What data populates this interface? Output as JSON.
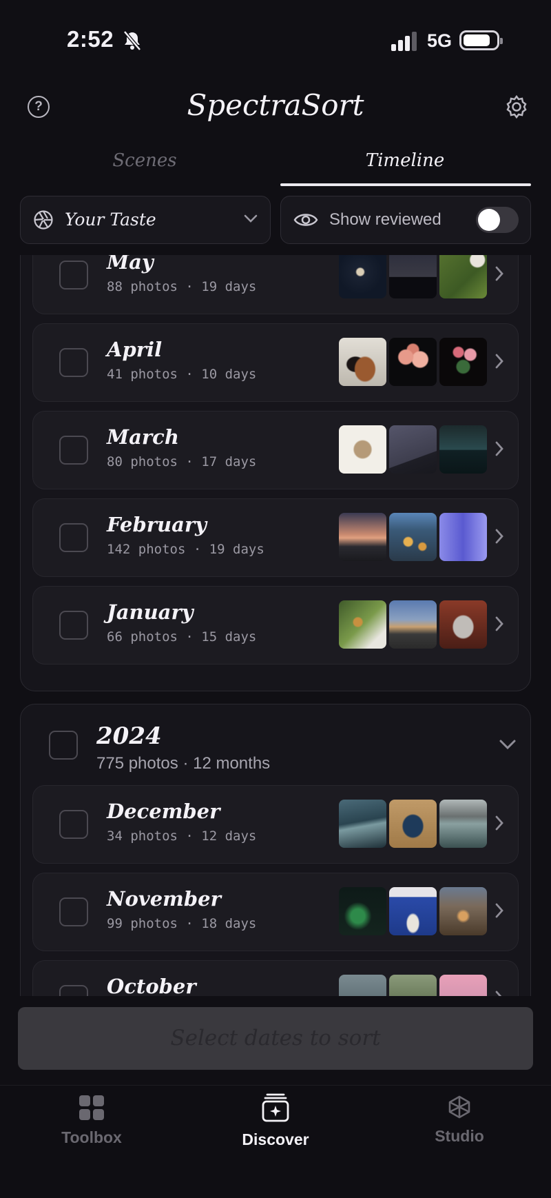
{
  "status_bar": {
    "time": "2:52",
    "network": "5G"
  },
  "header": {
    "title": "SpectraSort"
  },
  "tabs": [
    {
      "label": "Scenes",
      "active": false
    },
    {
      "label": "Timeline",
      "active": true
    }
  ],
  "filters": {
    "taste_label": "Your Taste",
    "show_reviewed_label": "Show reviewed",
    "show_reviewed_on": false
  },
  "years": [
    {
      "year": "",
      "months": [
        {
          "name": "May",
          "meta": "88 photos · 19 days",
          "thumb_colors": [
            "#101827",
            "#2a2a3a",
            "#4f6a2e"
          ]
        },
        {
          "name": "April",
          "meta": "41 photos · 10 days",
          "thumb_colors": [
            "#d8d4cc",
            "#8a3a3a",
            "#5a2a30"
          ]
        },
        {
          "name": "March",
          "meta": "80 photos · 17 days",
          "thumb_colors": [
            "#eeeae2",
            "#4a4a58",
            "#1e3238"
          ]
        },
        {
          "name": "February",
          "meta": "142 photos · 19 days",
          "thumb_colors": [
            "#b07a68",
            "#3e6a90",
            "#6a6adc"
          ]
        },
        {
          "name": "January",
          "meta": "66 photos · 15 days",
          "thumb_colors": [
            "#6f8a4a",
            "#6c88b8",
            "#7a3a2a"
          ]
        }
      ]
    },
    {
      "year": "2024",
      "meta": "775 photos · 12 months",
      "months": [
        {
          "name": "December",
          "meta": "34 photos · 12 days",
          "thumb_colors": [
            "#3a5560",
            "#b08a5a",
            "#7a8a8a"
          ]
        },
        {
          "name": "November",
          "meta": "99 photos · 18 days",
          "thumb_colors": [
            "#1f5a3a",
            "#2a4aa0",
            "#8a6a4a"
          ]
        },
        {
          "name": "October",
          "meta": "",
          "thumb_colors": [
            "#6a7a80",
            "#5a6a4a",
            "#d08aa0"
          ]
        }
      ]
    }
  ],
  "cta": {
    "label": "Select dates to sort"
  },
  "tabbar": [
    {
      "label": "Toolbox",
      "active": false
    },
    {
      "label": "Discover",
      "active": true
    },
    {
      "label": "Studio",
      "active": false
    }
  ],
  "colors": {
    "background": "#100f14",
    "card": "#1c1b21",
    "muted": "#6e6c75"
  }
}
